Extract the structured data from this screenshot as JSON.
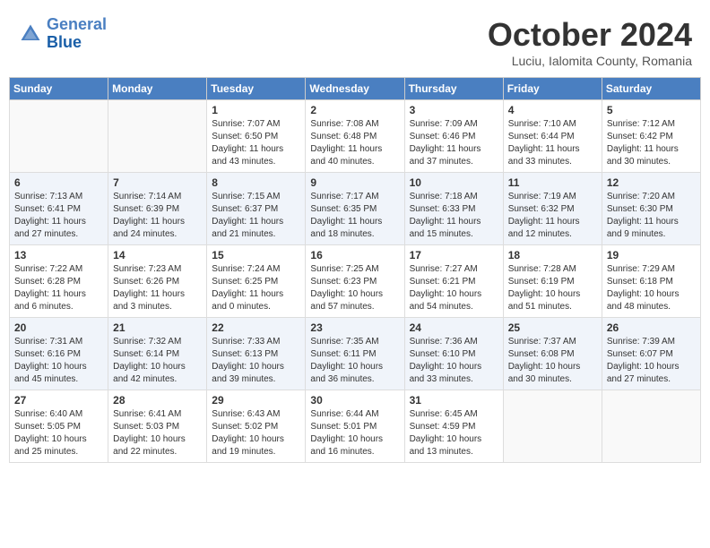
{
  "header": {
    "logo_line1": "General",
    "logo_line2": "Blue",
    "month_title": "October 2024",
    "location": "Luciu, Ialomita County, Romania"
  },
  "weekdays": [
    "Sunday",
    "Monday",
    "Tuesday",
    "Wednesday",
    "Thursday",
    "Friday",
    "Saturday"
  ],
  "weeks": [
    [
      {
        "day": "",
        "detail": ""
      },
      {
        "day": "",
        "detail": ""
      },
      {
        "day": "1",
        "detail": "Sunrise: 7:07 AM\nSunset: 6:50 PM\nDaylight: 11 hours and 43 minutes."
      },
      {
        "day": "2",
        "detail": "Sunrise: 7:08 AM\nSunset: 6:48 PM\nDaylight: 11 hours and 40 minutes."
      },
      {
        "day": "3",
        "detail": "Sunrise: 7:09 AM\nSunset: 6:46 PM\nDaylight: 11 hours and 37 minutes."
      },
      {
        "day": "4",
        "detail": "Sunrise: 7:10 AM\nSunset: 6:44 PM\nDaylight: 11 hours and 33 minutes."
      },
      {
        "day": "5",
        "detail": "Sunrise: 7:12 AM\nSunset: 6:42 PM\nDaylight: 11 hours and 30 minutes."
      }
    ],
    [
      {
        "day": "6",
        "detail": "Sunrise: 7:13 AM\nSunset: 6:41 PM\nDaylight: 11 hours and 27 minutes."
      },
      {
        "day": "7",
        "detail": "Sunrise: 7:14 AM\nSunset: 6:39 PM\nDaylight: 11 hours and 24 minutes."
      },
      {
        "day": "8",
        "detail": "Sunrise: 7:15 AM\nSunset: 6:37 PM\nDaylight: 11 hours and 21 minutes."
      },
      {
        "day": "9",
        "detail": "Sunrise: 7:17 AM\nSunset: 6:35 PM\nDaylight: 11 hours and 18 minutes."
      },
      {
        "day": "10",
        "detail": "Sunrise: 7:18 AM\nSunset: 6:33 PM\nDaylight: 11 hours and 15 minutes."
      },
      {
        "day": "11",
        "detail": "Sunrise: 7:19 AM\nSunset: 6:32 PM\nDaylight: 11 hours and 12 minutes."
      },
      {
        "day": "12",
        "detail": "Sunrise: 7:20 AM\nSunset: 6:30 PM\nDaylight: 11 hours and 9 minutes."
      }
    ],
    [
      {
        "day": "13",
        "detail": "Sunrise: 7:22 AM\nSunset: 6:28 PM\nDaylight: 11 hours and 6 minutes."
      },
      {
        "day": "14",
        "detail": "Sunrise: 7:23 AM\nSunset: 6:26 PM\nDaylight: 11 hours and 3 minutes."
      },
      {
        "day": "15",
        "detail": "Sunrise: 7:24 AM\nSunset: 6:25 PM\nDaylight: 11 hours and 0 minutes."
      },
      {
        "day": "16",
        "detail": "Sunrise: 7:25 AM\nSunset: 6:23 PM\nDaylight: 10 hours and 57 minutes."
      },
      {
        "day": "17",
        "detail": "Sunrise: 7:27 AM\nSunset: 6:21 PM\nDaylight: 10 hours and 54 minutes."
      },
      {
        "day": "18",
        "detail": "Sunrise: 7:28 AM\nSunset: 6:19 PM\nDaylight: 10 hours and 51 minutes."
      },
      {
        "day": "19",
        "detail": "Sunrise: 7:29 AM\nSunset: 6:18 PM\nDaylight: 10 hours and 48 minutes."
      }
    ],
    [
      {
        "day": "20",
        "detail": "Sunrise: 7:31 AM\nSunset: 6:16 PM\nDaylight: 10 hours and 45 minutes."
      },
      {
        "day": "21",
        "detail": "Sunrise: 7:32 AM\nSunset: 6:14 PM\nDaylight: 10 hours and 42 minutes."
      },
      {
        "day": "22",
        "detail": "Sunrise: 7:33 AM\nSunset: 6:13 PM\nDaylight: 10 hours and 39 minutes."
      },
      {
        "day": "23",
        "detail": "Sunrise: 7:35 AM\nSunset: 6:11 PM\nDaylight: 10 hours and 36 minutes."
      },
      {
        "day": "24",
        "detail": "Sunrise: 7:36 AM\nSunset: 6:10 PM\nDaylight: 10 hours and 33 minutes."
      },
      {
        "day": "25",
        "detail": "Sunrise: 7:37 AM\nSunset: 6:08 PM\nDaylight: 10 hours and 30 minutes."
      },
      {
        "day": "26",
        "detail": "Sunrise: 7:39 AM\nSunset: 6:07 PM\nDaylight: 10 hours and 27 minutes."
      }
    ],
    [
      {
        "day": "27",
        "detail": "Sunrise: 6:40 AM\nSunset: 5:05 PM\nDaylight: 10 hours and 25 minutes."
      },
      {
        "day": "28",
        "detail": "Sunrise: 6:41 AM\nSunset: 5:03 PM\nDaylight: 10 hours and 22 minutes."
      },
      {
        "day": "29",
        "detail": "Sunrise: 6:43 AM\nSunset: 5:02 PM\nDaylight: 10 hours and 19 minutes."
      },
      {
        "day": "30",
        "detail": "Sunrise: 6:44 AM\nSunset: 5:01 PM\nDaylight: 10 hours and 16 minutes."
      },
      {
        "day": "31",
        "detail": "Sunrise: 6:45 AM\nSunset: 4:59 PM\nDaylight: 10 hours and 13 minutes."
      },
      {
        "day": "",
        "detail": ""
      },
      {
        "day": "",
        "detail": ""
      }
    ]
  ]
}
